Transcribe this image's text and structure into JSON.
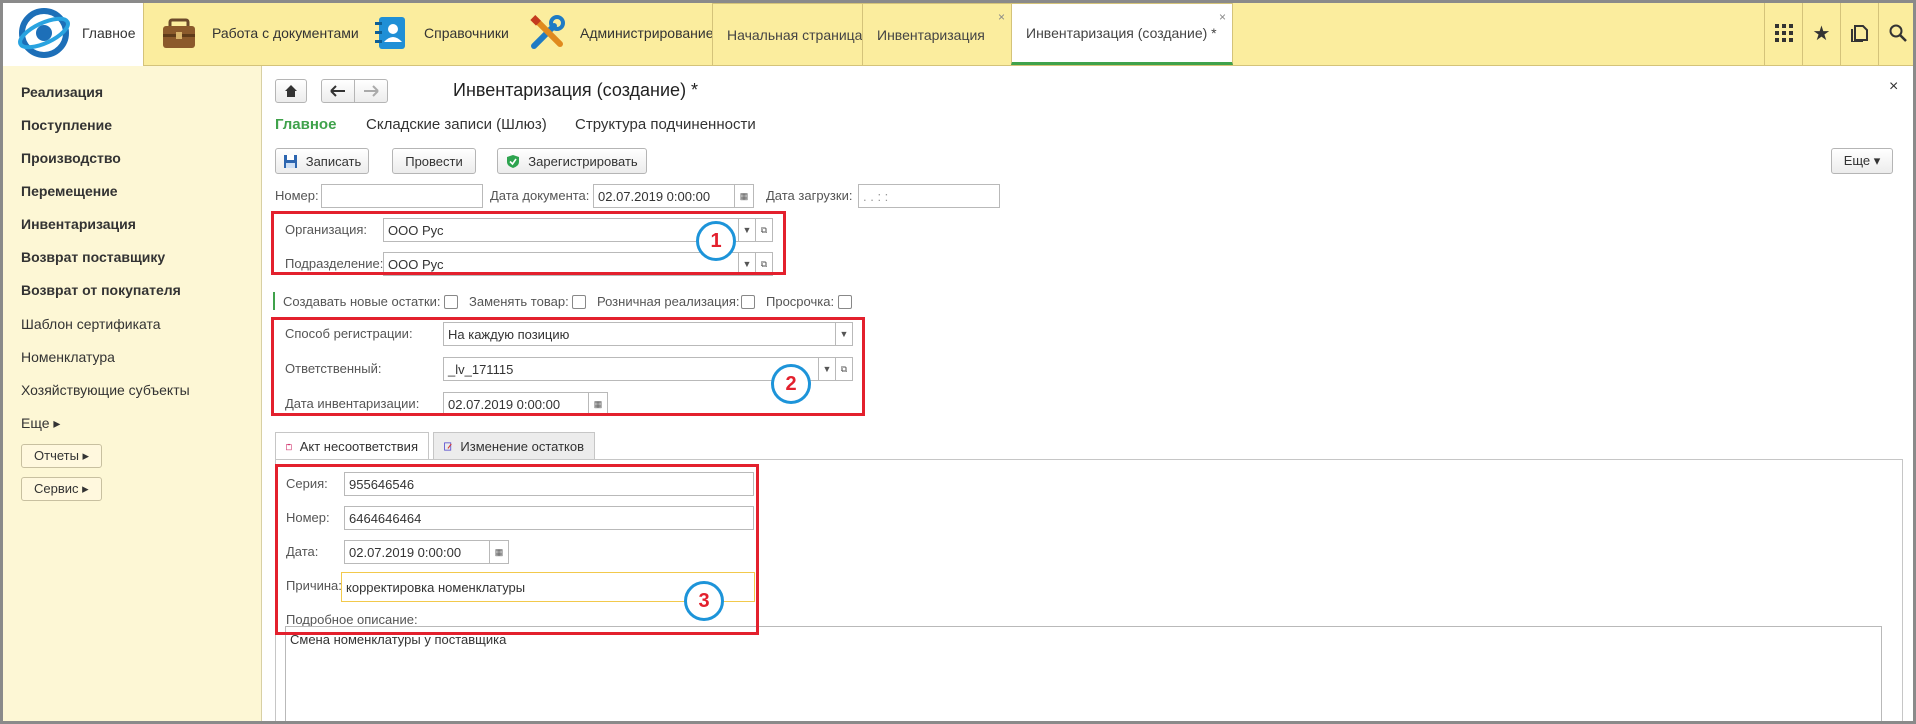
{
  "topbar": {
    "sections": [
      {
        "label": "Главное",
        "icon": "home-logo-icon"
      },
      {
        "label": "Работа с документами",
        "icon": "briefcase-icon"
      },
      {
        "label": "Справочники",
        "icon": "address-book-icon"
      },
      {
        "label": "Администрирование",
        "icon": "tools-icon"
      }
    ],
    "tabs": [
      {
        "label": "Начальная страница",
        "closable": false
      },
      {
        "label": "Инвентаризация",
        "closable": true
      },
      {
        "label": "Инвентаризация (создание) *",
        "closable": true,
        "active": true
      }
    ],
    "close_glyph": "×",
    "icons": [
      "apps-grid-icon",
      "star-icon",
      "history-icon",
      "search-icon"
    ],
    "icon_glyphs": {
      "apps": "⋮⋮⋮",
      "star": "★",
      "history": "🗍",
      "search": "⌕"
    },
    "accent_color": "#fbed9e"
  },
  "sidebar": {
    "items": [
      {
        "label": "Реализация",
        "bold": true
      },
      {
        "label": "Поступление",
        "bold": true
      },
      {
        "label": "Производство",
        "bold": true
      },
      {
        "label": "Перемещение",
        "bold": true
      },
      {
        "label": "Инвентаризация",
        "bold": true
      },
      {
        "label": "Возврат поставщику",
        "bold": true
      },
      {
        "label": "Возврат от покупателя",
        "bold": true
      },
      {
        "label": "Шаблон сертификата",
        "bold": false
      },
      {
        "label": "Номенклатура",
        "bold": false
      },
      {
        "label": "Хозяйствующие субъекты",
        "bold": false
      },
      {
        "label": "Еще ▸",
        "bold": false
      }
    ],
    "buttons": [
      "Отчеты ▸",
      "Сервис ▸"
    ]
  },
  "form": {
    "title": "Инвентаризация (создание) *",
    "close": "×",
    "nav_links": [
      "Главное",
      "Складские записи (Шлюз)",
      "Структура подчиненности"
    ],
    "toolbar": {
      "save": "Записать",
      "post": "Провести",
      "register": "Зарегистрировать",
      "more": "Еще ▾"
    },
    "header": {
      "number_label": "Номер:",
      "number_value": "",
      "doc_date_label": "Дата документа:",
      "doc_date_value": "02.07.2019  0:00:00",
      "load_date_label": "Дата загрузки:",
      "load_date_value": " .  .       :   :"
    },
    "org_label": "Организация:",
    "org_value": "ООО Рус",
    "dept_label": "Подразделение:",
    "dept_value": "ООО Рус",
    "checkboxes": [
      {
        "label": "Создавать новые остатки:",
        "checked": false
      },
      {
        "label": "Заменять товар:",
        "checked": false
      },
      {
        "label": "Розничная реализация:",
        "checked": false
      },
      {
        "label": "Просрочка:",
        "checked": false
      }
    ],
    "reg_method_label": "Способ регистрации:",
    "reg_method_value": "На каждую позицию",
    "responsible_label": "Ответственный:",
    "responsible_value": "_lv_171115",
    "inv_date_label": "Дата инвентаризации:",
    "inv_date_value": "02.07.2019  0:00:00",
    "tabs": [
      "Акт несоответствия",
      "Изменение остатков"
    ],
    "act": {
      "series_label": "Серия:",
      "series_value": "955646546",
      "number_label": "Номер:",
      "number_value": "6464646464",
      "date_label": "Дата:",
      "date_value": "02.07.2019  0:00:00",
      "reason_label": "Причина:",
      "reason_value": "корректировка номенклатуры",
      "desc_label": "Подробное описание:",
      "desc_value": "Смена номенклатуры у поставщика"
    },
    "markers": [
      "1",
      "2",
      "3"
    ],
    "highlight_color": "#e3202d",
    "marker_color": "#1d94d9"
  }
}
